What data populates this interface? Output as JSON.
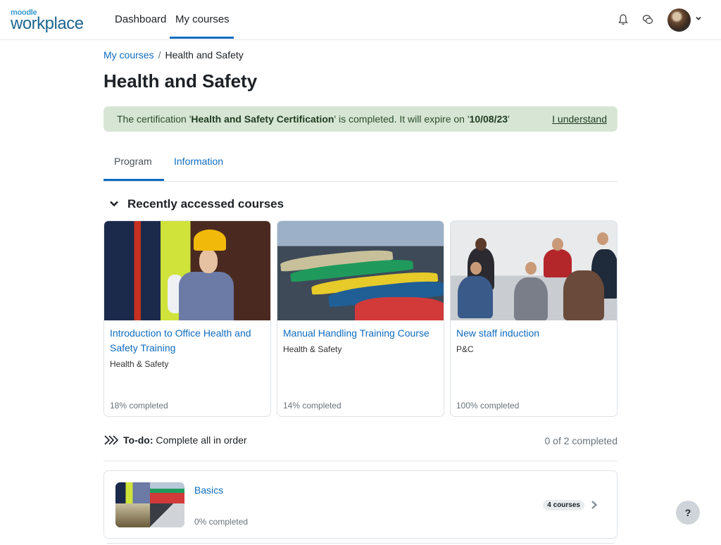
{
  "brand": {
    "logo_small": "moodle",
    "logo_big": "workplace"
  },
  "nav": {
    "items": [
      {
        "label": "Dashboard",
        "active": false
      },
      {
        "label": "My courses",
        "active": true
      }
    ],
    "icons": [
      "bell-icon",
      "chat-icon"
    ],
    "user_menu": "avatar-dropdown"
  },
  "breadcrumb": {
    "parent": "My courses",
    "separator": "/",
    "current": "Health and Safety"
  },
  "page_title": "Health and Safety",
  "alert": {
    "prefix": "The certification '",
    "certification": "Health and Safety Certification",
    "middle": "' is completed. It will expire on '",
    "expiry": "10/08/23",
    "suffix": "'",
    "dismiss": "I understand",
    "color": "#d7e6d4"
  },
  "tabs": [
    {
      "label": "Program",
      "active": true
    },
    {
      "label": "Information",
      "active": false
    }
  ],
  "recent": {
    "heading": "Recently accessed courses",
    "courses": [
      {
        "title": "Introduction to Office Health and Safety Training",
        "category": "Health & Safety",
        "progress": "18% completed",
        "image": "worker-in-ppe"
      },
      {
        "title": "Manual Handling Training Course",
        "category": "Health & Safety",
        "progress": "14% completed",
        "image": "weight-plates"
      },
      {
        "title": "New staff induction",
        "category": "P&C",
        "progress": "100% completed",
        "image": "team-meeting"
      }
    ]
  },
  "todo": {
    "label": "To-do:",
    "text": "Complete all in order",
    "count": "0 of 2 completed"
  },
  "program_items": [
    {
      "title": "Basics",
      "progress": "0% completed",
      "badge": "4 courses"
    }
  ],
  "help": "?",
  "colors": {
    "accent": "#0f6cbf"
  }
}
